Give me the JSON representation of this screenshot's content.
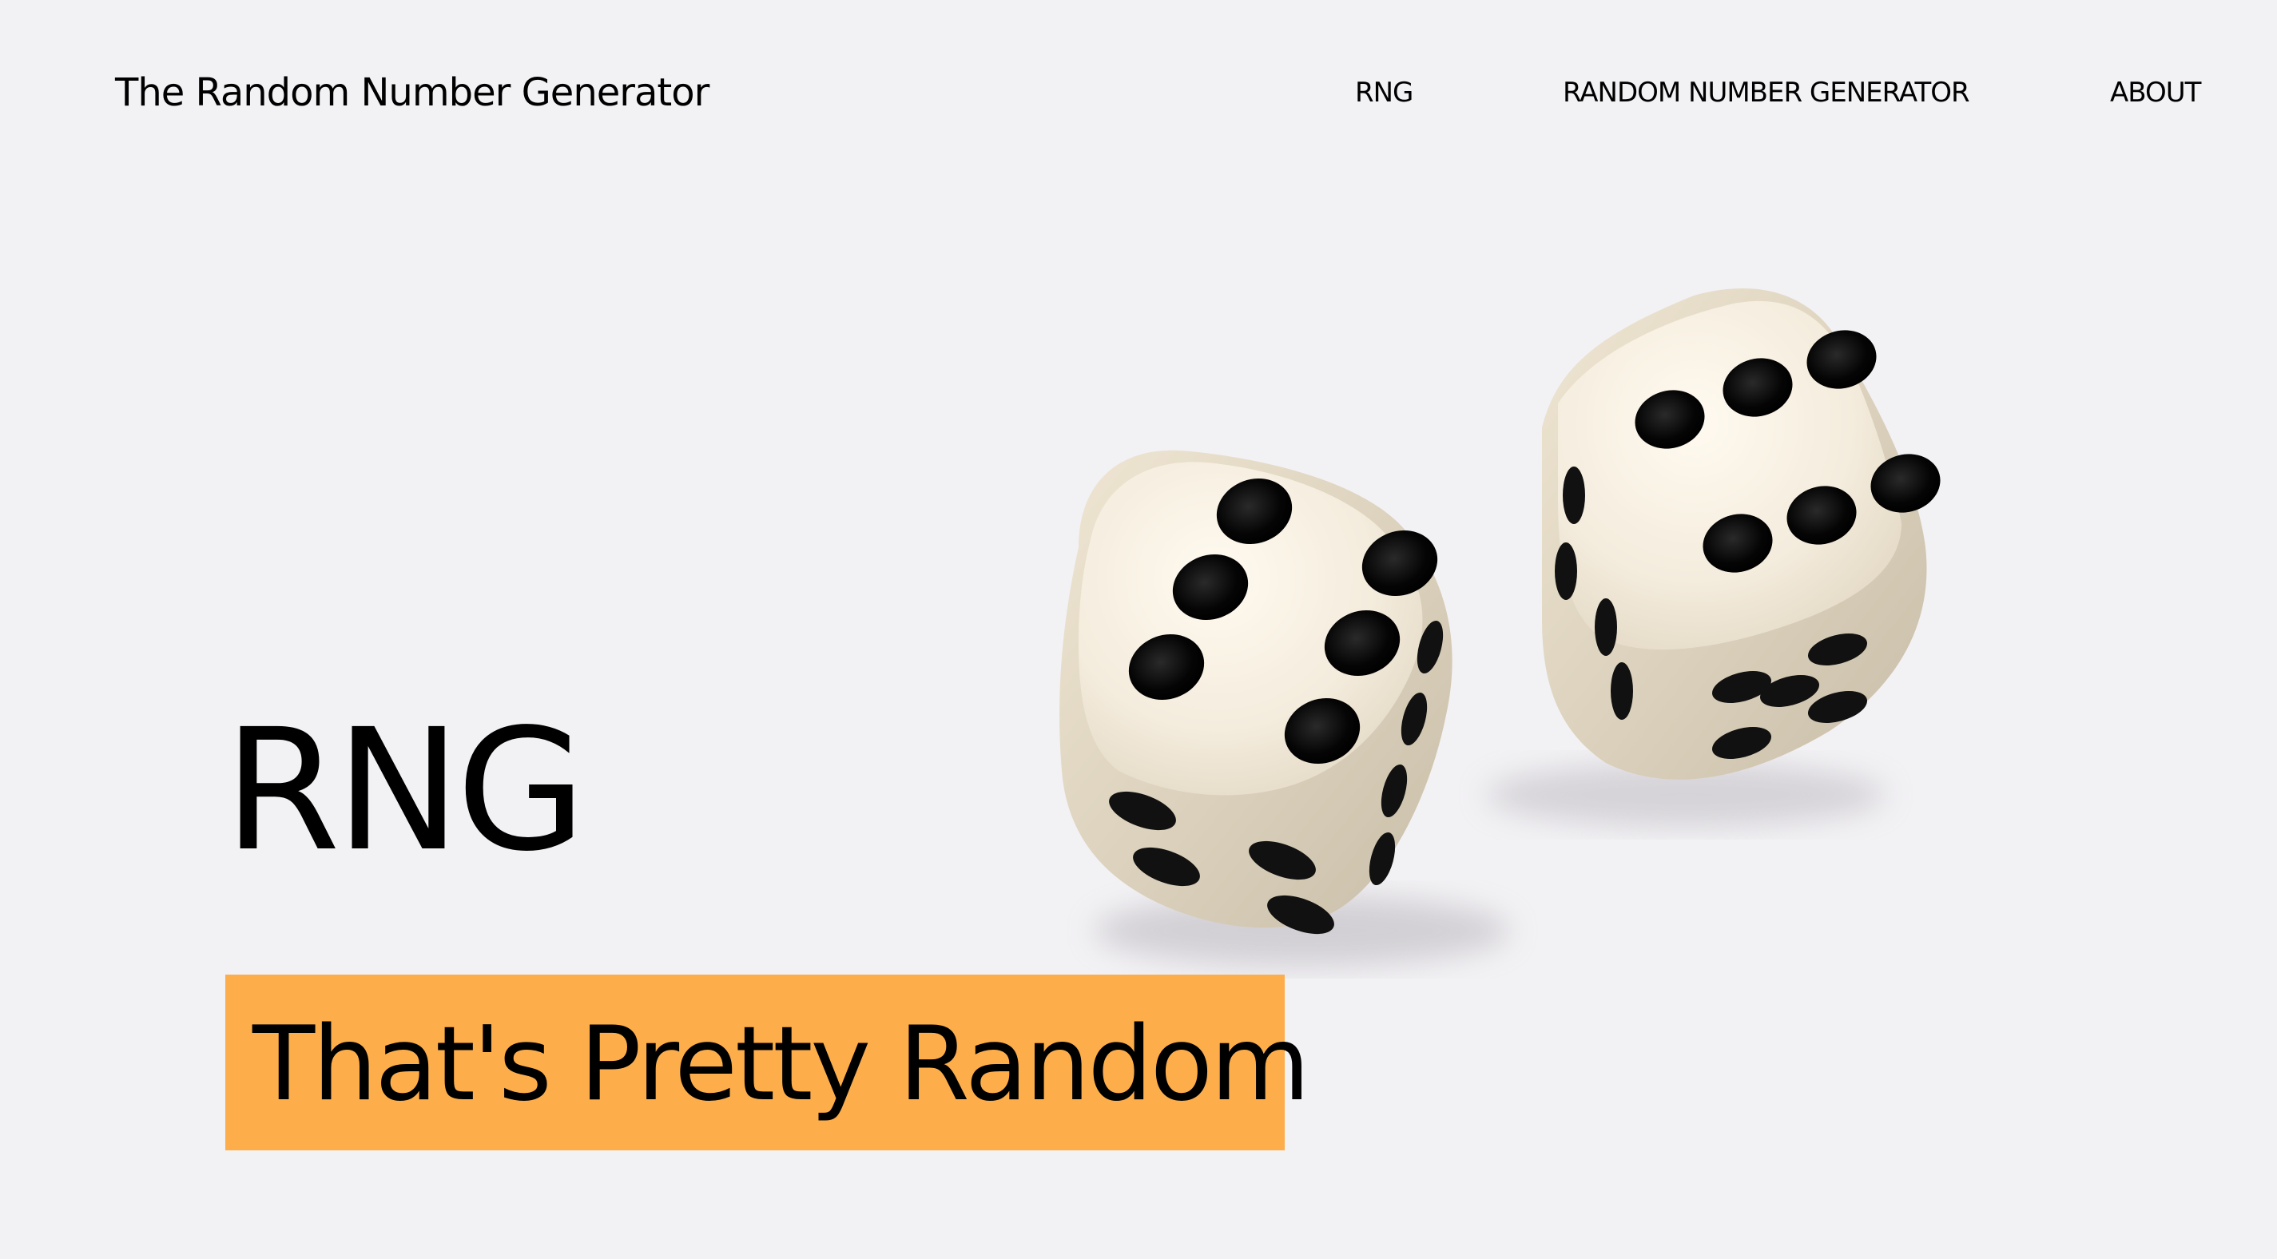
{
  "header": {
    "site_title": "The Random Number Generator",
    "nav": [
      {
        "label": "RNG"
      },
      {
        "label": "RANDOM NUMBER GENERATOR"
      },
      {
        "label": "ABOUT"
      }
    ]
  },
  "hero": {
    "title": "RNG",
    "tagline": "That's Pretty Random",
    "image_label": "dice-image"
  },
  "colors": {
    "background": "#f2f1f4",
    "accent": "#fdae4b",
    "text": "#000000"
  }
}
